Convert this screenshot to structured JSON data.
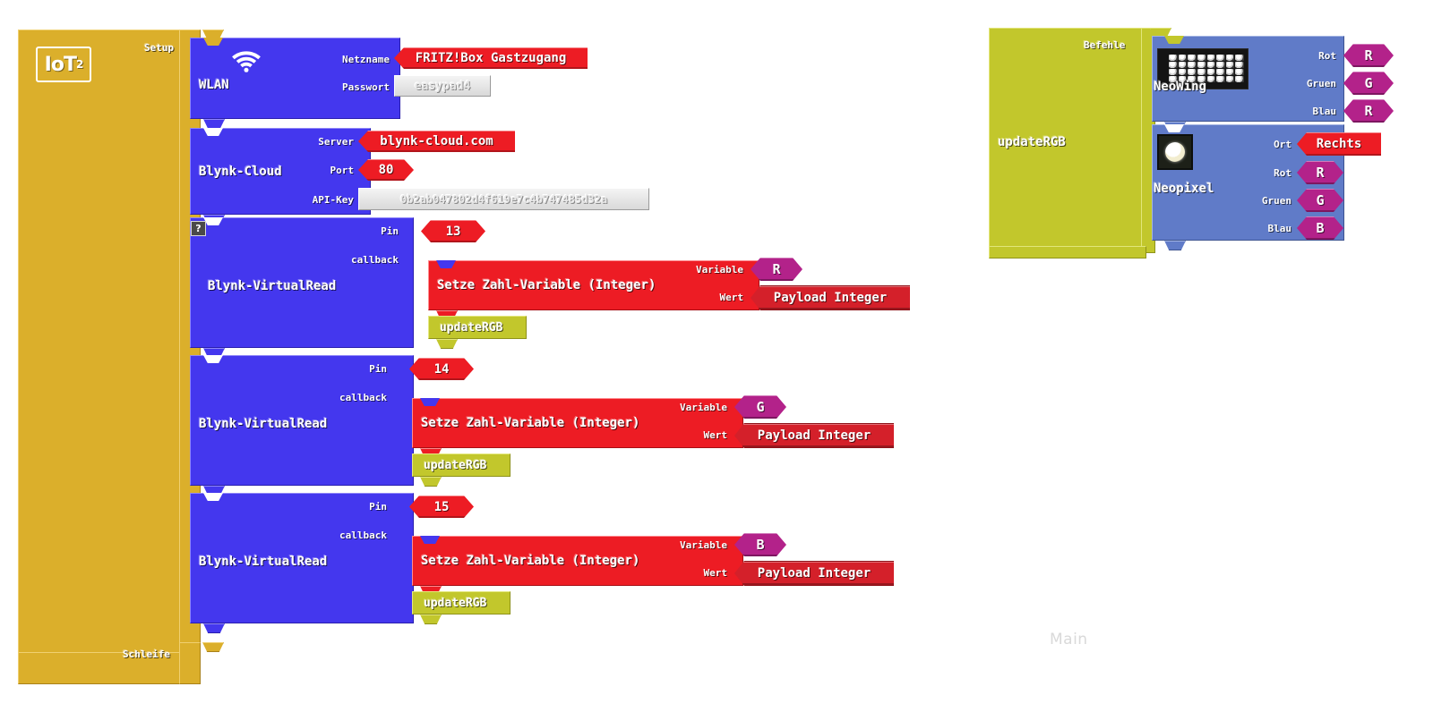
{
  "app": {
    "logo_text": "IoT",
    "logo_sup": "2",
    "watermark": "Main"
  },
  "setup_container": {
    "hat_label": "Setup",
    "loop_label": "Schleife"
  },
  "blocks": {
    "wlan": {
      "name": "WLAN",
      "icon": "wifi-icon",
      "fields": [
        {
          "label": "Netzname",
          "value": "FRITZ!Box Gastzugang",
          "kind": "string-plug"
        },
        {
          "label": "Passwort",
          "value": "easypad4",
          "kind": "text-input"
        }
      ]
    },
    "blynk_cloud": {
      "name": "Blynk-Cloud",
      "fields": [
        {
          "label": "Server",
          "value": "blynk-cloud.com",
          "kind": "string-plug"
        },
        {
          "label": "Port",
          "value": "80",
          "kind": "number-plug"
        },
        {
          "label": "API-Key",
          "value": "0b2ab047802d4f619e7c4b747485d32a",
          "kind": "text-input"
        }
      ]
    },
    "virtual_reads": [
      {
        "name": "Blynk-VirtualRead",
        "has_help_badge": true,
        "pin_label": "Pin",
        "pin_value": "13",
        "callback_label": "callback",
        "statement": {
          "name": "Setze Zahl-Variable (Integer)",
          "variable_label": "Variable",
          "variable_value": "R",
          "wert_label": "Wert",
          "wert_value": "Payload Integer"
        },
        "call": "updateRGB"
      },
      {
        "name": "Blynk-VirtualRead",
        "has_help_badge": false,
        "pin_label": "Pin",
        "pin_value": "14",
        "callback_label": "callback",
        "statement": {
          "name": "Setze Zahl-Variable (Integer)",
          "variable_label": "Variable",
          "variable_value": "G",
          "wert_label": "Wert",
          "wert_value": "Payload Integer"
        },
        "call": "updateRGB"
      },
      {
        "name": "Blynk-VirtualRead",
        "has_help_badge": false,
        "pin_label": "Pin",
        "pin_value": "15",
        "callback_label": "callback",
        "statement": {
          "name": "Setze Zahl-Variable (Integer)",
          "variable_label": "Variable",
          "variable_value": "B",
          "wert_label": "Wert",
          "wert_value": "Payload Integer"
        },
        "call": "updateRGB"
      }
    ]
  },
  "procedure": {
    "name": "updateRGB",
    "commands_label": "Befehle",
    "neowing": {
      "name": "NeoWing",
      "icon": "led-matrix-icon",
      "slots": [
        {
          "label": "Rot",
          "value": "R"
        },
        {
          "label": "Gruen",
          "value": "G"
        },
        {
          "label": "Blau",
          "value": "R"
        }
      ]
    },
    "neopixel": {
      "name": "Neopixel",
      "icon": "led-pixel-icon",
      "ort_label": "Ort",
      "ort_value": "Rechts",
      "slots": [
        {
          "label": "Rot",
          "value": "R"
        },
        {
          "label": "Gruen",
          "value": "G"
        },
        {
          "label": "Blau",
          "value": "B"
        }
      ]
    }
  },
  "colors": {
    "setup_gold": "#DBAF2B",
    "procedure_olive": "#C2C72C",
    "block_blue": "#4437EE",
    "hardware_blue": "#607BC8",
    "statement_red": "#ED1C24",
    "variable_magenta": "#B3228A"
  }
}
